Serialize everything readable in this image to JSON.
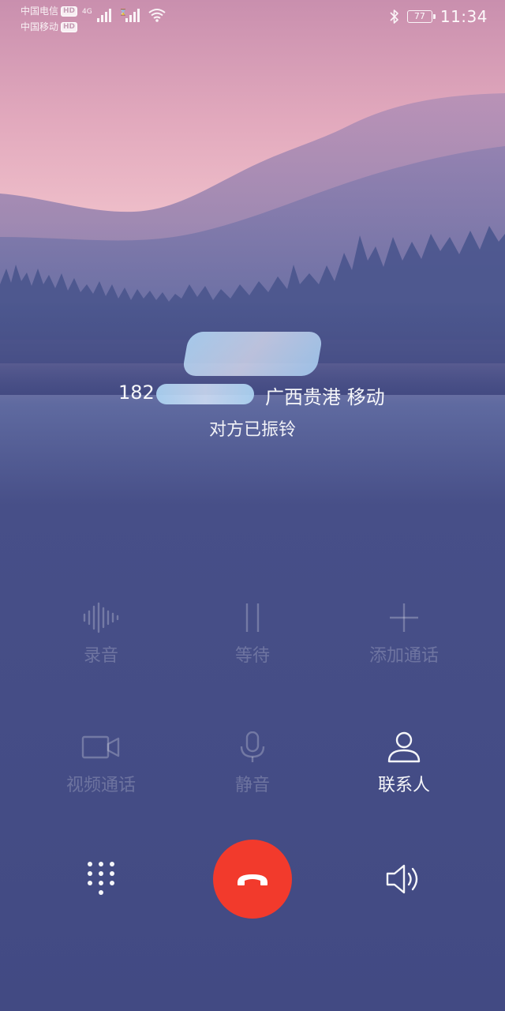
{
  "status_bar": {
    "carrier_1": "中国电信",
    "carrier_2": "中国移动",
    "hd_badge": "HD",
    "network_type": "4G",
    "battery_level": "77",
    "time": "11:34"
  },
  "caller": {
    "number_prefix": "182",
    "location": "广西贵港 移动",
    "call_status": "对方已振铃"
  },
  "actions": {
    "record": {
      "label": "录音",
      "icon": "waveform-icon",
      "enabled": false
    },
    "hold": {
      "label": "等待",
      "icon": "pause-icon",
      "enabled": false
    },
    "add_call": {
      "label": "添加通话",
      "icon": "plus-icon",
      "enabled": false
    },
    "video_call": {
      "label": "视频通话",
      "icon": "video-camera-icon",
      "enabled": false
    },
    "mute": {
      "label": "静音",
      "icon": "microphone-icon",
      "enabled": false
    },
    "contacts": {
      "label": "联系人",
      "icon": "person-icon",
      "enabled": true
    }
  },
  "bottom": {
    "dialpad_icon": "dialpad-icon",
    "end_call_icon": "hang-up-icon",
    "speaker_icon": "speaker-icon"
  },
  "colors": {
    "end_call": "#f23a2c",
    "background": "#434a82",
    "sky_pink": "#e9b8c6"
  }
}
